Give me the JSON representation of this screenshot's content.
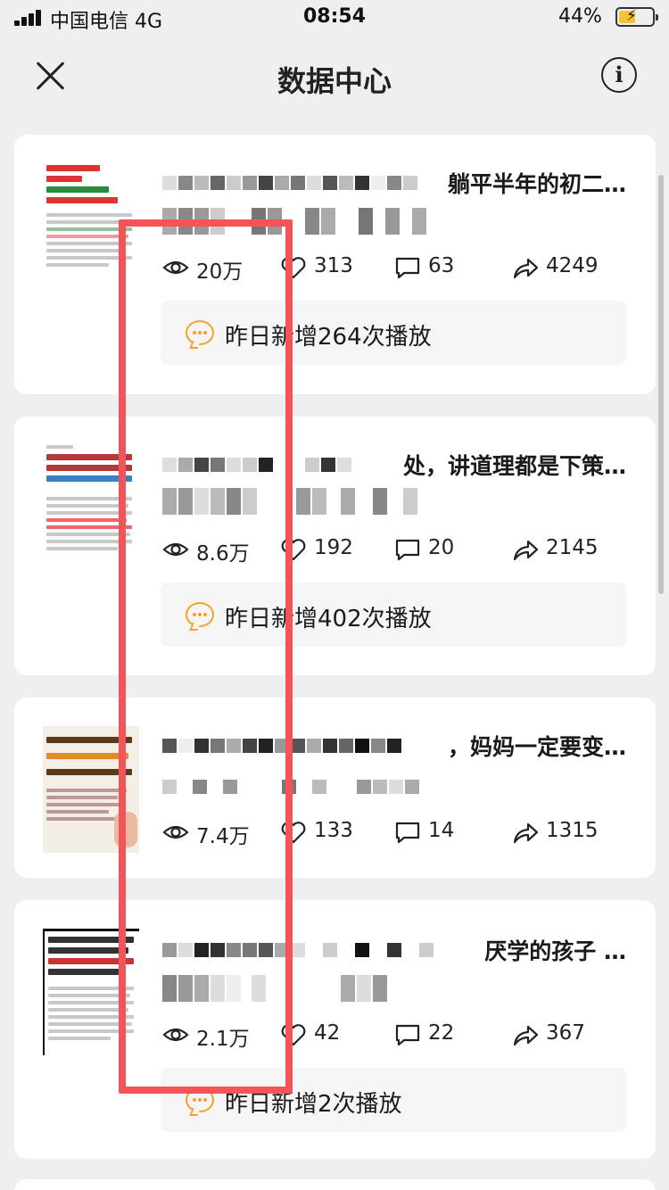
{
  "status_bar": {
    "carrier": "中国电信  4G",
    "time": "08:54",
    "battery_percent": "44%",
    "battery_level": 0.44
  },
  "nav": {
    "title": "数据中心",
    "close_icon": "close-icon",
    "info_icon": "info-icon",
    "info_glyph": "i"
  },
  "cards": [
    {
      "title_visible": "躺平半年的初二…",
      "views": "20万",
      "likes": "313",
      "comments": "63",
      "shares": "4249",
      "growth": "昨日新增264次播放",
      "thumb_text": [
        "当我变成“狠心”",
        "的妈妈，",
        "躺平半年的儿子，",
        "终于重新站起来了！"
      ]
    },
    {
      "title_visible": "处，讲道理都是下策…",
      "views": "8.6万",
      "likes": "192",
      "comments": "20",
      "shares": "2145",
      "growth": "昨日新增402次播放",
      "thumb_text": [
        "跟青春期孩子相处，讲道",
        "是下策，闭嘴远离是中",
        "真正的上策，到底是什"
      ]
    },
    {
      "title_visible": "，妈妈一定要变…",
      "views": "7.4万",
      "likes": "133",
      "comments": "14",
      "shares": "1315",
      "growth": "",
      "thumb_text": [
        "养育青春期孩子",
        "妈妈一定要变成傻白甜",
        "特别是女孩妈妈"
      ]
    },
    {
      "title_visible": "厌学的孩子 …",
      "views": "2.1万",
      "likes": "42",
      "comments": "22",
      "shares": "367",
      "growth": "昨日新增2次播放",
      "thumb_text": [
        "放手半年，儿子变得自律",
        "又优秀，我才醒悟：",
        "会翻脸”的家长，永",
        "不出自觉的孩子"
      ]
    }
  ],
  "icons": {
    "views": "eye-icon",
    "likes": "heart-icon",
    "comments": "comment-icon",
    "shares": "share-icon",
    "growth": "message-bubble-icon"
  },
  "colors": {
    "accent_orange": "#f5a12b",
    "annotation_red": "#f2545a",
    "background": "#efefef"
  }
}
